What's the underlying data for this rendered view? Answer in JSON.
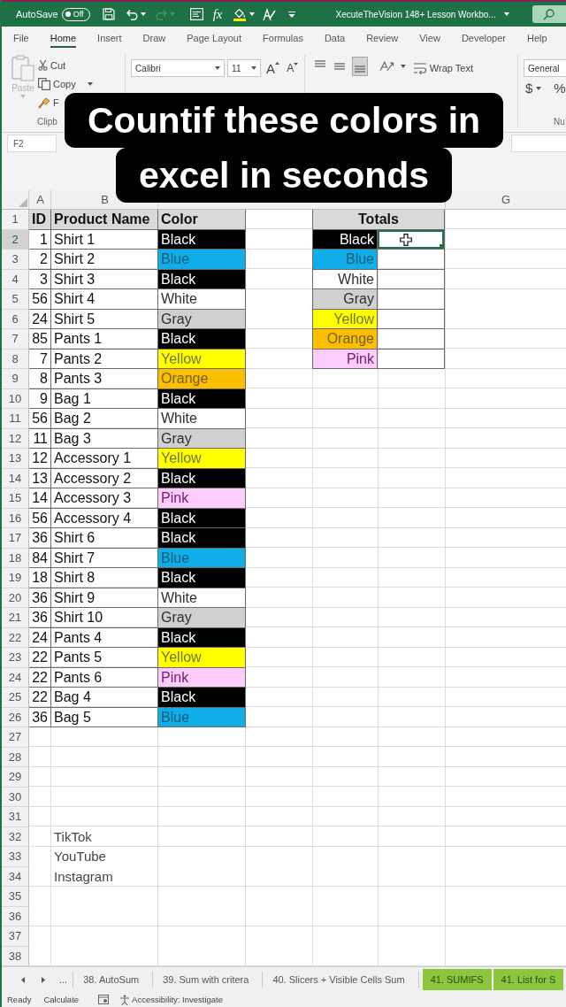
{
  "title_bar": {
    "autosave_label": "AutoSave",
    "autosave_toggle": {
      "label": "Off",
      "on": false
    },
    "redo": {
      "disabled": true
    },
    "function_label": "fx",
    "document_title": "XecuteTheVision 148+ Lesson Workbo..."
  },
  "ribbon_tabs": [
    {
      "label": "File",
      "selected": false
    },
    {
      "label": "Home",
      "selected": true
    },
    {
      "label": "Insert",
      "selected": false
    },
    {
      "label": "Draw",
      "selected": false
    },
    {
      "label": "Page Layout",
      "selected": false
    },
    {
      "label": "Formulas",
      "selected": false
    },
    {
      "label": "Data",
      "selected": false
    },
    {
      "label": "Review",
      "selected": false
    },
    {
      "label": "View",
      "selected": false
    },
    {
      "label": "Developer",
      "selected": false
    },
    {
      "label": "Help",
      "selected": false
    }
  ],
  "ribbon": {
    "clipboard": {
      "paste": {
        "label": "Paste",
        "disabled": true
      },
      "cut": "Cut",
      "copy": "Copy",
      "format_painter": "F",
      "group_label": "Clipb"
    },
    "font": {
      "name": "Calibri",
      "size": "11",
      "grow": "A",
      "shrink": "A"
    },
    "alignment": [
      {
        "kind": "top",
        "selected": false
      },
      {
        "kind": "middle",
        "selected": false
      },
      {
        "kind": "bottom",
        "selected": true
      }
    ],
    "wrap_text": "Wrap Text",
    "number": {
      "format": "General",
      "currency": "$",
      "percent": "%",
      "group_label": "Nu"
    }
  },
  "formula_bar": {
    "name_box": "F2"
  },
  "caption": {
    "lines": [
      "Countif these colors in",
      "excel in seconds"
    ]
  },
  "grid": {
    "column_headers": {
      "left": [
        "A",
        "B"
      ],
      "right": [
        "G"
      ]
    },
    "rows": [
      {
        "number": "1",
        "selected": false,
        "kind": "header",
        "id": "ID",
        "product": "Product Name",
        "swatch": {
          "text": "Color"
        },
        "total": {
          "text": "Totals"
        }
      },
      {
        "number": "2",
        "selected": true,
        "kind": "data",
        "id": "1",
        "product": "Shirt 1",
        "swatch": {
          "text": "Black",
          "color": "#000000"
        },
        "total": {
          "text": "Black",
          "color": "#000000",
          "selected": true
        }
      },
      {
        "number": "3",
        "selected": false,
        "kind": "data",
        "id": "2",
        "product": "Shirt 2",
        "swatch": {
          "text": "Blue",
          "color": "#10aee8"
        },
        "total": {
          "text": "Blue",
          "color": "#10aee8",
          "selected": false
        }
      },
      {
        "number": "4",
        "selected": false,
        "kind": "data",
        "id": "3",
        "product": "Shirt 3",
        "swatch": {
          "text": "Black",
          "color": "#000000"
        },
        "total": {
          "text": "White",
          "color": "#ffffff",
          "selected": false
        }
      },
      {
        "number": "5",
        "selected": false,
        "kind": "data",
        "id": "56",
        "product": "Shirt 4",
        "swatch": {
          "text": "White",
          "color": "#ffffff"
        },
        "total": {
          "text": "Gray",
          "color": "#d0d0d0",
          "selected": false
        }
      },
      {
        "number": "6",
        "selected": false,
        "kind": "data",
        "id": "24",
        "product": "Shirt 5",
        "swatch": {
          "text": "Gray",
          "color": "#d0d0d0"
        },
        "total": {
          "text": "Yellow",
          "color": "#ffff00",
          "selected": false
        }
      },
      {
        "number": "7",
        "selected": false,
        "kind": "data",
        "id": "85",
        "product": "Pants 1",
        "swatch": {
          "text": "Black",
          "color": "#000000"
        },
        "total": {
          "text": "Orange",
          "color": "#fbbf00",
          "selected": false
        }
      },
      {
        "number": "8",
        "selected": false,
        "kind": "data",
        "id": "7",
        "product": "Pants 2",
        "swatch": {
          "text": "Yellow",
          "color": "#ffff00"
        },
        "total": {
          "text": "Pink",
          "color": "#fcccfc",
          "selected": false
        }
      },
      {
        "number": "9",
        "selected": false,
        "kind": "data",
        "id": "8",
        "product": "Pants 3",
        "swatch": {
          "text": "Orange",
          "color": "#fbbf00"
        }
      },
      {
        "number": "10",
        "selected": false,
        "kind": "data",
        "id": "9",
        "product": "Bag 1",
        "swatch": {
          "text": "Black",
          "color": "#000000"
        }
      },
      {
        "number": "11",
        "selected": false,
        "kind": "data",
        "id": "56",
        "product": "Bag 2",
        "swatch": {
          "text": "White",
          "color": "#ffffff"
        }
      },
      {
        "number": "12",
        "selected": false,
        "kind": "data",
        "id": "11",
        "product": "Bag 3",
        "swatch": {
          "text": "Gray",
          "color": "#d0d0d0"
        }
      },
      {
        "number": "13",
        "selected": false,
        "kind": "data",
        "id": "12",
        "product": "Accessory 1",
        "swatch": {
          "text": "Yellow",
          "color": "#ffff00"
        }
      },
      {
        "number": "14",
        "selected": false,
        "kind": "data",
        "id": "13",
        "product": "Accessory 2",
        "swatch": {
          "text": "Black",
          "color": "#000000"
        }
      },
      {
        "number": "15",
        "selected": false,
        "kind": "data",
        "id": "14",
        "product": "Accessory 3",
        "swatch": {
          "text": "Pink",
          "color": "#fcccfc"
        }
      },
      {
        "number": "16",
        "selected": false,
        "kind": "data",
        "id": "56",
        "product": "Accessory 4",
        "swatch": {
          "text": "Black",
          "color": "#000000"
        }
      },
      {
        "number": "17",
        "selected": false,
        "kind": "data",
        "id": "36",
        "product": "Shirt 6",
        "swatch": {
          "text": "Black",
          "color": "#000000"
        }
      },
      {
        "number": "18",
        "selected": false,
        "kind": "data",
        "id": "84",
        "product": "Shirt 7",
        "swatch": {
          "text": "Blue",
          "color": "#10aee8"
        }
      },
      {
        "number": "19",
        "selected": false,
        "kind": "data",
        "id": "18",
        "product": "Shirt 8",
        "swatch": {
          "text": "Black",
          "color": "#000000"
        }
      },
      {
        "number": "20",
        "selected": false,
        "kind": "data",
        "id": "36",
        "product": "Shirt 9",
        "swatch": {
          "text": "White",
          "color": "#ffffff"
        }
      },
      {
        "number": "21",
        "selected": false,
        "kind": "data",
        "id": "36",
        "product": "Shirt 10",
        "swatch": {
          "text": "Gray",
          "color": "#d0d0d0"
        }
      },
      {
        "number": "22",
        "selected": false,
        "kind": "data",
        "id": "24",
        "product": "Pants 4",
        "swatch": {
          "text": "Black",
          "color": "#000000"
        }
      },
      {
        "number": "23",
        "selected": false,
        "kind": "data",
        "id": "22",
        "product": "Pants 5",
        "swatch": {
          "text": "Yellow",
          "color": "#ffff00"
        }
      },
      {
        "number": "24",
        "selected": false,
        "kind": "data",
        "id": "22",
        "product": "Pants 6",
        "swatch": {
          "text": "Pink",
          "color": "#fcccfc"
        }
      },
      {
        "number": "25",
        "selected": false,
        "kind": "data",
        "id": "22",
        "product": "Bag 4",
        "swatch": {
          "text": "Black",
          "color": "#000000"
        }
      },
      {
        "number": "26",
        "selected": false,
        "kind": "data",
        "id": "36",
        "product": "Bag 5",
        "swatch": {
          "text": "Blue",
          "color": "#10aee8"
        }
      },
      {
        "number": "27",
        "selected": false,
        "kind": "empty"
      },
      {
        "number": "28",
        "selected": false,
        "kind": "empty"
      },
      {
        "number": "29",
        "selected": false,
        "kind": "empty"
      },
      {
        "number": "30",
        "selected": false,
        "kind": "empty"
      },
      {
        "number": "31",
        "selected": false,
        "kind": "empty"
      },
      {
        "number": "32",
        "selected": false,
        "kind": "note",
        "product": "TikTok"
      },
      {
        "number": "33",
        "selected": false,
        "kind": "note",
        "product": "YouTube"
      },
      {
        "number": "34",
        "selected": false,
        "kind": "note",
        "product": "Instagram"
      },
      {
        "number": "35",
        "selected": false,
        "kind": "empty"
      },
      {
        "number": "36",
        "selected": false,
        "kind": "empty"
      },
      {
        "number": "37",
        "selected": false,
        "kind": "empty"
      },
      {
        "number": "38",
        "selected": false,
        "kind": "empty"
      }
    ]
  },
  "sheet_tabs": {
    "overflow": "...",
    "tabs": [
      {
        "label": "38. AutoSum",
        "selected": false
      },
      {
        "label": "39. Sum with critera",
        "selected": false
      },
      {
        "label": "40. Slicers + Visible Cells Sum",
        "selected": false
      },
      {
        "label": "41. SUMIFS",
        "selected": false,
        "color": "#8cc63f"
      },
      {
        "label": "41. List for S",
        "selected": false,
        "color": "#8cc63f"
      }
    ]
  },
  "status_bar": {
    "items": [
      "Ready",
      "Calculate"
    ],
    "accessibility": "Accessibility: Investigate"
  }
}
